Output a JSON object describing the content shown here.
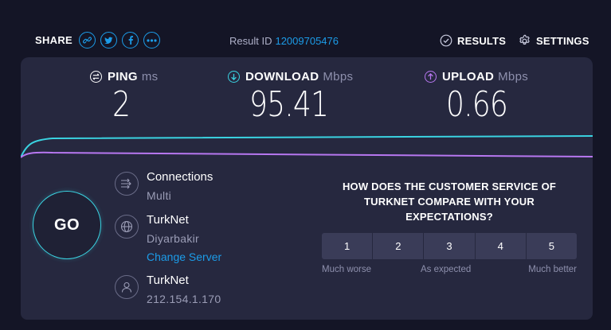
{
  "header": {
    "share_label": "SHARE",
    "share_icons": [
      "link-icon",
      "twitter-icon",
      "facebook-icon",
      "more-icon"
    ],
    "result_id_label": "Result ID",
    "result_id_value": "12009705476",
    "results_label": "RESULTS",
    "settings_label": "SETTINGS"
  },
  "metrics": {
    "ping": {
      "label": "PING",
      "unit": "ms",
      "value": "2",
      "color": "#ffffff"
    },
    "download": {
      "label": "DOWNLOAD",
      "unit": "Mbps",
      "value": "95.41",
      "color": "#3ad3e1"
    },
    "upload": {
      "label": "UPLOAD",
      "unit": "Mbps",
      "value": "0.66",
      "color": "#b777f0"
    }
  },
  "go_label": "GO",
  "connections": {
    "title": "Connections",
    "value": "Multi"
  },
  "server": {
    "title": "TurkNet",
    "location": "Diyarbakir",
    "change_label": "Change Server"
  },
  "isp": {
    "title": "TurkNet",
    "ip": "212.154.1.170"
  },
  "survey": {
    "question": "HOW DOES THE CUSTOMER SERVICE OF TURKNET COMPARE WITH YOUR EXPECTATIONS?",
    "options": [
      "1",
      "2",
      "3",
      "4",
      "5"
    ],
    "label_low": "Much worse",
    "label_mid": "As expected",
    "label_high": "Much better"
  },
  "colors": {
    "background": "#141526",
    "panel": "#26283f",
    "accent_blue": "#1c9ce8",
    "download_cyan": "#3ad3e1",
    "upload_purple": "#b777f0"
  }
}
